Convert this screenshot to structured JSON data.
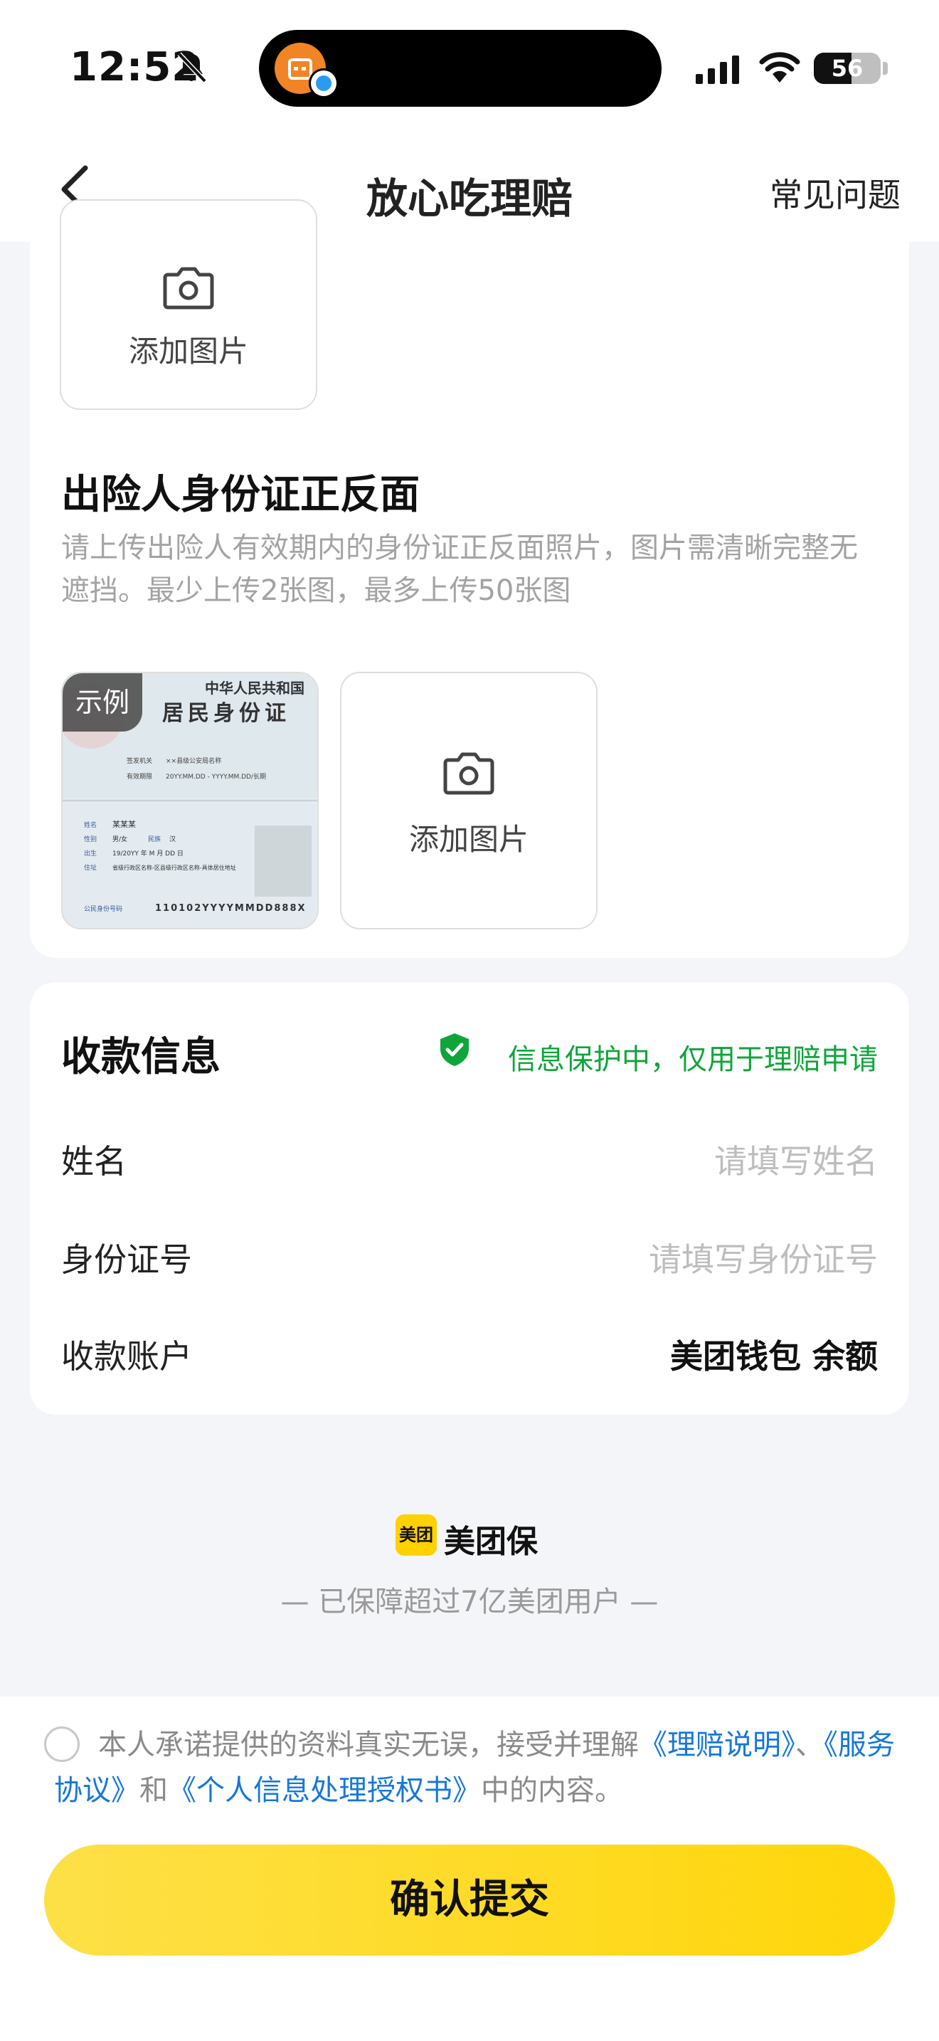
{
  "status_bar": {
    "time": "12:52",
    "battery_level": "56",
    "battery_fraction": 0.56
  },
  "header": {
    "title": "放心吃理赔",
    "faq_label": "常见问题"
  },
  "upload_section_top": {
    "add_image_label": "添加图片"
  },
  "id_card_section": {
    "title": "出险人身份证正反面",
    "description": "请上传出险人有效期内的身份证正反面照片，图片需清晰完整无遮挡。最少上传2张图，最多上传50张图",
    "example_tag": "示例",
    "add_image_label": "添加图片",
    "example_card_text": {
      "front_line1": "中华人民共和国",
      "front_line2": "居民身份证",
      "authority_label": "签发机关",
      "authority_value": "××县级公安局名称",
      "valid_label": "有效期限",
      "valid_value": "20YY.MM.DD - YYYY.MM.DD/长期",
      "name_label": "姓名",
      "name_value": "某某某",
      "gender_label": "性别",
      "gender_value": "男/女",
      "ethnicity_label": "民族",
      "ethnicity_value": "汉",
      "birth_label": "出生",
      "birth_value": "19/20YY 年 M 月 DD 日",
      "address_label": "住址",
      "address_value": "省级行政区名称-区县级行政区名称-具体居住地址",
      "id_label": "公民身份号码",
      "id_value": "110102YYYYMMDD888X"
    }
  },
  "payment_section": {
    "title": "收款信息",
    "protect_text": "信息保护中，仅用于理赔申请",
    "name_label": "姓名",
    "name_placeholder": "请填写姓名",
    "id_label": "身份证号",
    "id_placeholder": "请填写身份证号",
    "account_label": "收款账户",
    "account_value": "美团钱包 余额"
  },
  "brand": {
    "logo_text": "美团",
    "name": "美团保",
    "guarantee": "— 已保障超过7亿美团用户 —"
  },
  "footer": {
    "agree_prefix": "本人承诺提供的资料真实无误，接受并理解",
    "link_claim": "《理赔说明》",
    "sep": "、",
    "link_service": "《服务协议》",
    "and": "和",
    "link_privacy": "《个人信息处理授权书》",
    "agree_suffix": "中的内容。",
    "submit_label": "确认提交"
  },
  "colors": {
    "accent_yellow": "#ffd60a",
    "link_blue": "#1677d9",
    "protect_green": "#10a53b"
  },
  "icons": [
    "bell-slash-icon",
    "signal-icon",
    "wifi-icon",
    "battery-icon",
    "back-arrow-icon",
    "camera-icon",
    "shield-check-icon"
  ]
}
